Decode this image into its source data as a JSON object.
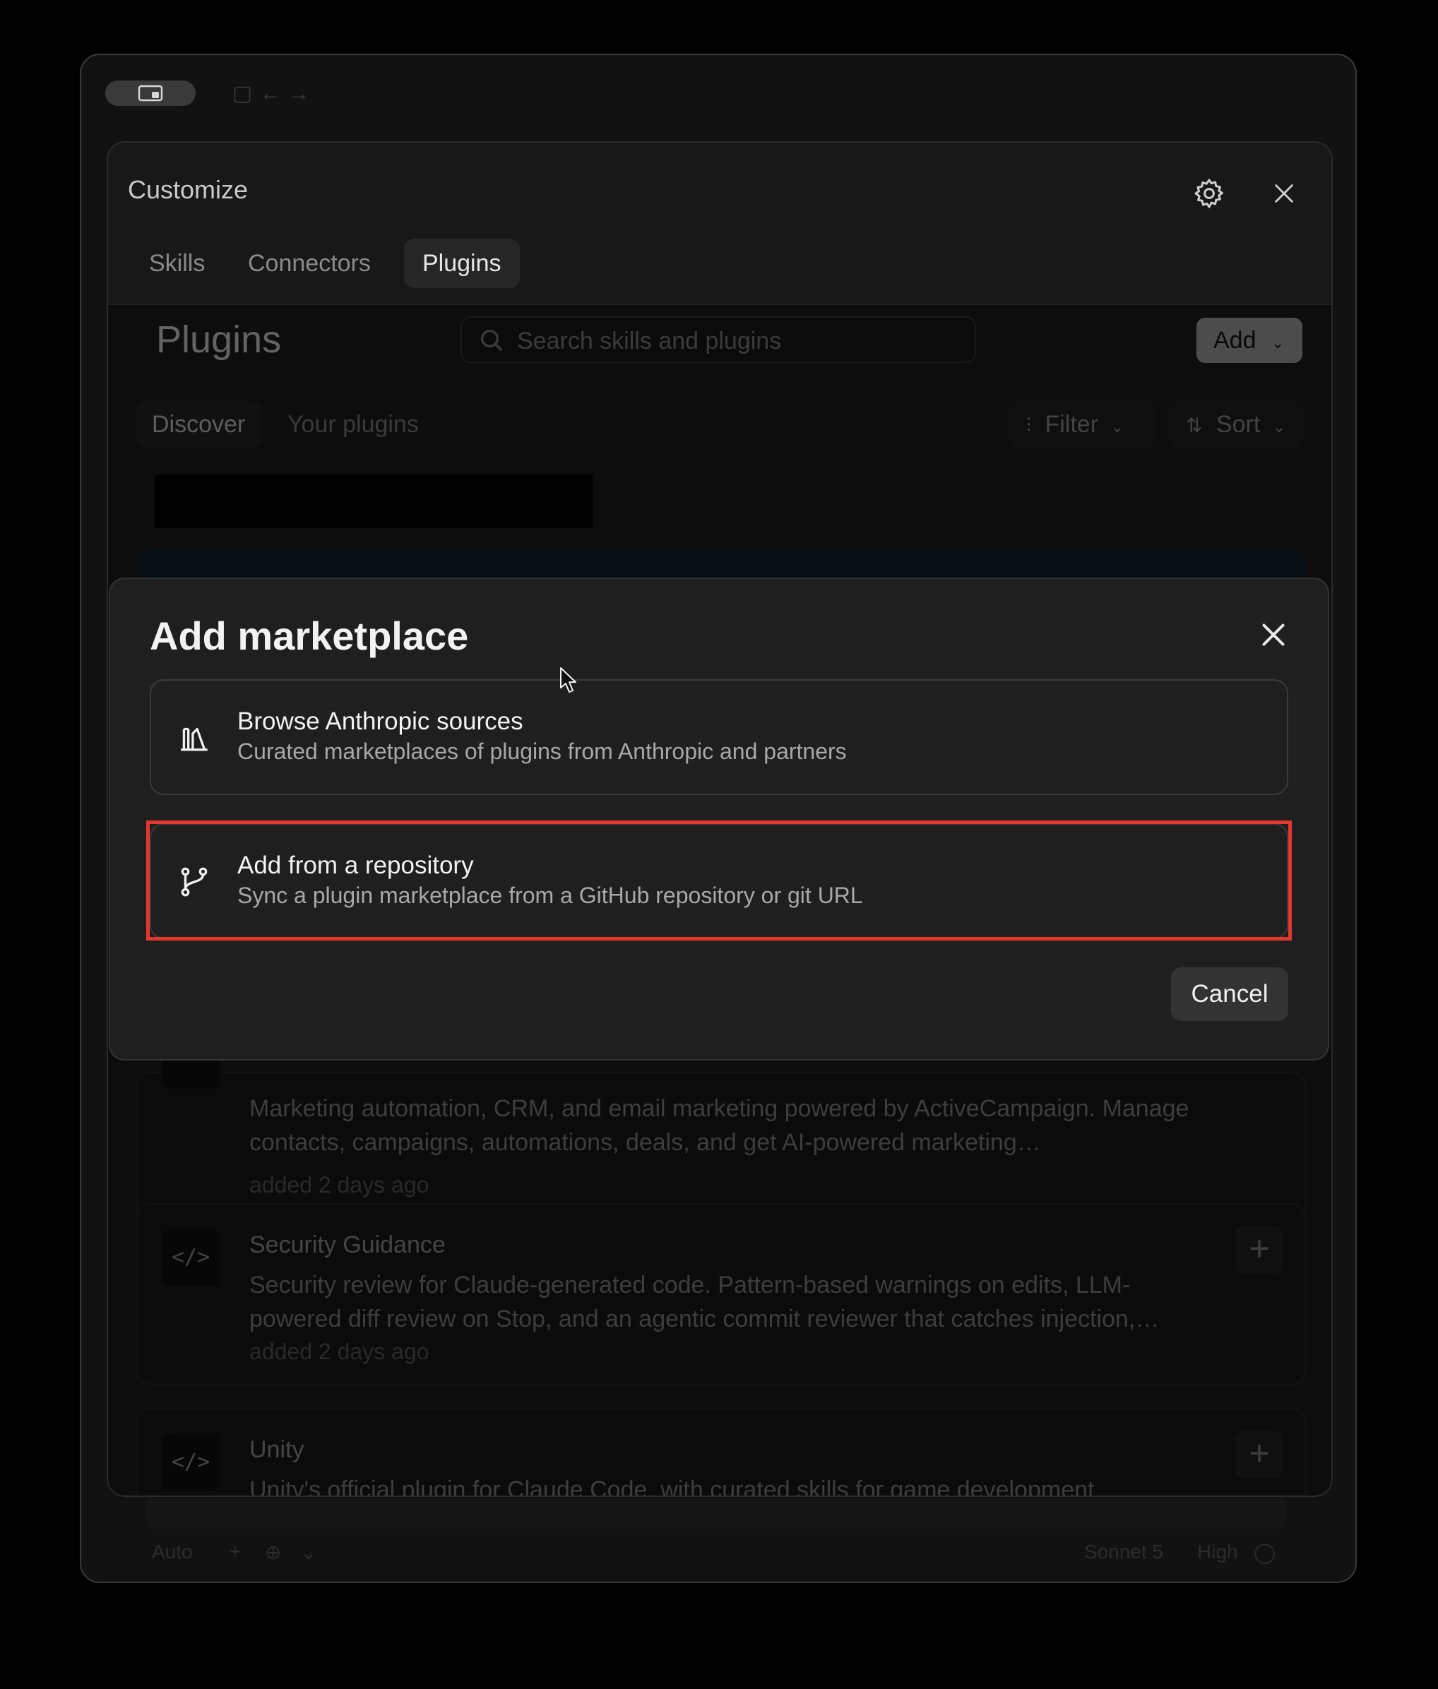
{
  "window": {
    "bottom_left": [
      "Auto",
      "+",
      "⊕",
      "⌄"
    ],
    "bottom_right": [
      "Sonnet 5",
      "High",
      "◯"
    ]
  },
  "customize": {
    "title": "Customize",
    "tabs": [
      "Skills",
      "Connectors",
      "Plugins"
    ],
    "active_tab": "Plugins"
  },
  "plugins_page": {
    "heading": "Plugins",
    "search_placeholder": "Search skills and plugins",
    "add_label": "Add",
    "subtabs": [
      "Discover",
      "Your plugins"
    ],
    "filter_label": "Filter",
    "sort_label": "Sort",
    "cards": [
      {
        "name": "",
        "desc": "Marketing automation, CRM, and email marketing powered by ActiveCampaign. Manage contacts, campaigns, automations, deals, and get AI-powered marketing…",
        "meta": "added 2 days ago"
      },
      {
        "name": "Security Guidance",
        "desc": "Security review for Claude-generated code. Pattern-based warnings on edits, LLM-powered diff review on Stop, and an agentic commit reviewer that catches injection,…",
        "meta": "added 2 days ago"
      },
      {
        "name": "Unity",
        "desc": "Unity's official plugin for Claude Code, with curated skills for game development",
        "meta": ""
      }
    ],
    "code_icon_text": "</>"
  },
  "modal": {
    "title": "Add marketplace",
    "options": [
      {
        "title": "Browse Anthropic sources",
        "desc": "Curated marketplaces of plugins from Anthropic and partners",
        "icon": "library-icon"
      },
      {
        "title": "Add from a repository",
        "desc": "Sync a plugin marketplace from a GitHub repository or git URL",
        "icon": "git-branch-icon"
      }
    ],
    "cancel_label": "Cancel",
    "highlight_color": "#e3372e"
  }
}
